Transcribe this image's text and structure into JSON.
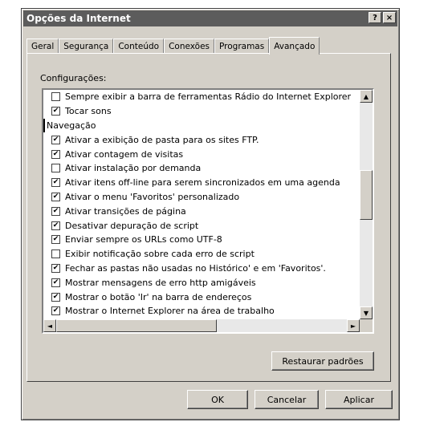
{
  "window": {
    "title": "Opções da Internet",
    "help_btn": "?",
    "close_btn": "×"
  },
  "tabs": [
    {
      "label": "Geral",
      "active": false
    },
    {
      "label": "Segurança",
      "active": false
    },
    {
      "label": "Conteúdo",
      "active": false
    },
    {
      "label": "Conexões",
      "active": false
    },
    {
      "label": "Programas",
      "active": false
    },
    {
      "label": "Avançado",
      "active": true
    }
  ],
  "panel": {
    "settings_label": "Configurações:",
    "items": [
      {
        "text": "Sempre exibir a barra de ferramentas Rádio do Internet Explorer",
        "checked": false
      },
      {
        "text": "Tocar sons",
        "checked": true
      },
      {
        "text": "Navegação",
        "heading": true
      },
      {
        "text": "Ativar a exibição de pasta para os sites FTP.",
        "checked": true
      },
      {
        "text": "Ativar contagem de visitas",
        "checked": true
      },
      {
        "text": "Ativar instalação por demanda",
        "checked": false
      },
      {
        "text": "Ativar itens off-line para serem sincronizados em uma agenda",
        "checked": true
      },
      {
        "text": "Ativar o menu 'Favoritos' personalizado",
        "checked": true
      },
      {
        "text": "Ativar transições de página",
        "checked": true
      },
      {
        "text": "Desativar depuração de script",
        "checked": true
      },
      {
        "text": "Enviar sempre os URLs como UTF-8",
        "checked": true
      },
      {
        "text": "Exibir notificação sobre cada erro de script",
        "checked": false
      },
      {
        "text": "Fechar as pastas não usadas no Histórico' e em 'Favoritos'.",
        "checked": true
      },
      {
        "text": "Mostrar mensagens de erro http amigáveis",
        "checked": true
      },
      {
        "text": "Mostrar o botão 'Ir' na barra de endereços",
        "checked": true
      },
      {
        "text": "Mostrar o Internet Explorer na área de trabalho",
        "checked": true
      }
    ],
    "restore_btn": "Restaurar padrões"
  },
  "footer": {
    "ok": "OK",
    "cancel": "Cancelar",
    "apply": "Aplicar"
  },
  "icons": {
    "scroll_up": "▲",
    "scroll_down": "▼",
    "scroll_left": "◄",
    "scroll_right": "►",
    "check": "✔"
  }
}
